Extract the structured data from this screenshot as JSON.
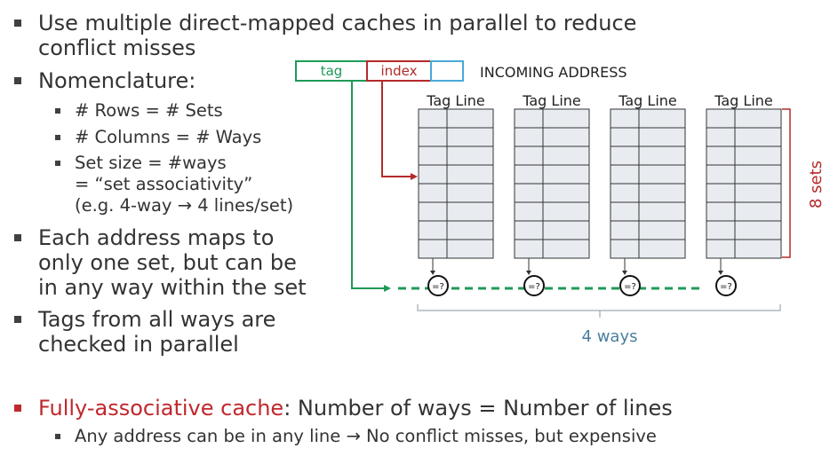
{
  "bullets": {
    "b1": [
      "Use multiple direct-mapped caches in parallel to reduce",
      "conflict misses"
    ],
    "b2": "Nomenclature:",
    "b2_sub": [
      [
        "# Rows = # Sets"
      ],
      [
        "# Columns = # Ways"
      ],
      [
        "Set size = #ways",
        "= “set associativity”",
        "(e.g. 4-way → 4 lines/set)"
      ]
    ],
    "b3": [
      "Each address maps to",
      "only one set, but can be",
      "in any way within the set"
    ],
    "b4": [
      "Tags from all ways are",
      "checked in parallel"
    ],
    "b5_highlight": "Fully-associative cache",
    "b5_rest": ": Number of ways =  Number of lines",
    "b5_sub": "Any address can be in any line → No conflict misses, but expensive"
  },
  "diagram": {
    "address_fields": [
      "tag",
      "index"
    ],
    "address_label": "INCOMING  ADDRESS",
    "way_header": "Tag Line",
    "sets_label": "8 sets",
    "ways_label": "4 ways",
    "comparator_label": "=?",
    "num_ways": 4,
    "num_sets": 8,
    "colors": {
      "tag": "#1e9a58",
      "index": "#b52a2a",
      "offset": "#4aa9d8",
      "sets_brace": "#b52a2a",
      "ways_label": "#4a7fa0",
      "cell_fill": "#e8ecf0",
      "cell_stroke": "#333333"
    }
  }
}
